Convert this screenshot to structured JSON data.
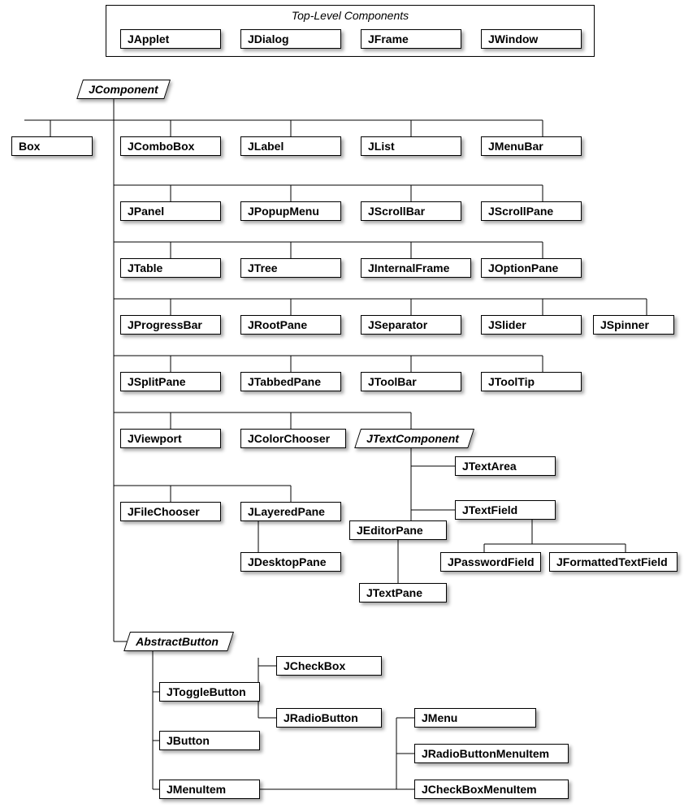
{
  "topContainer": {
    "title": "Top-Level Components"
  },
  "top": {
    "japplet": "JApplet",
    "jdialog": "JDialog",
    "jframe": "JFrame",
    "jwindow": "JWindow"
  },
  "jcomponent": "JComponent",
  "box": "Box",
  "row1": {
    "jcombobox": "JComboBox",
    "jlabel": "JLabel",
    "jlist": "JList",
    "jmenubar": "JMenuBar"
  },
  "row2": {
    "jpanel": "JPanel",
    "jpopupmenu": "JPopupMenu",
    "jscrollbar": "JScrollBar",
    "jscrollpane": "JScrollPane"
  },
  "row3": {
    "jtable": "JTable",
    "jtree": "JTree",
    "jinternalframe": "JInternalFrame",
    "joptionpane": "JOptionPane"
  },
  "row4": {
    "jprogressbar": "JProgressBar",
    "jrootpane": "JRootPane",
    "jseparator": "JSeparator",
    "jslider": "JSlider",
    "jspinner": "JSpinner"
  },
  "row5": {
    "jsplitpane": "JSplitPane",
    "jtabbedpane": "JTabbedPane",
    "jtoolbar": "JToolBar",
    "jtooltip": "JToolTip"
  },
  "row6": {
    "jviewport": "JViewport",
    "jcolorchooser": "JColorChooser",
    "jtextcomponent": "JTextComponent"
  },
  "row7": {
    "jfilechooser": "JFileChooser",
    "jlayeredpane": "JLayeredPane"
  },
  "text": {
    "jtextarea": "JTextArea",
    "jtextfield": "JTextField",
    "jeditorpane": "JEditorPane",
    "jpasswordfield": "JPasswordField",
    "jformattedtextfield": "JFormattedTextField",
    "jtextpane": "JTextPane"
  },
  "layered": {
    "jdesktoppane": "JDesktopPane"
  },
  "abstractbutton": "AbstractButton",
  "buttons": {
    "jtogglebutton": "JToggleButton",
    "jbutton": "JButton",
    "jmenuitem": "JMenuItem",
    "jcheckbox": "JCheckBox",
    "jradiobutton": "JRadioButton",
    "jmenu": "JMenu",
    "jradiobuttonmenuitem": "JRadioButtonMenuItem",
    "jcheckboxmenuitem": "JCheckBoxMenuItem"
  }
}
